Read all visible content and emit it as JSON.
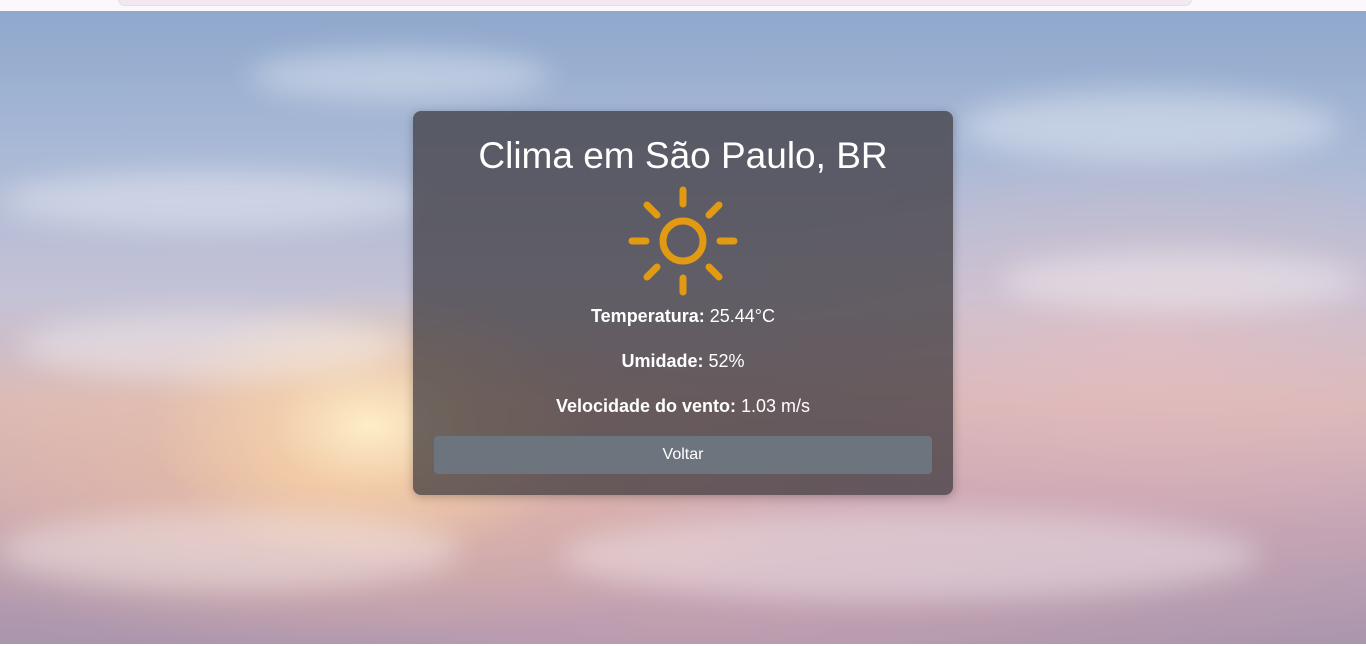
{
  "weather": {
    "title": "Clima em São Paulo, BR",
    "icon": "sun-icon",
    "icon_color": "#e29a12",
    "temperature_label": "Temperatura:",
    "temperature_value": "25.44°C",
    "humidity_label": "Umidade:",
    "humidity_value": "52%",
    "wind_label": "Velocidade do vento:",
    "wind_value": "1.03 m/s",
    "back_label": "Voltar"
  },
  "colors": {
    "card_background": "rgba(58,54,58,0.72)",
    "button_background": "#6c757d",
    "text": "#ffffff"
  }
}
